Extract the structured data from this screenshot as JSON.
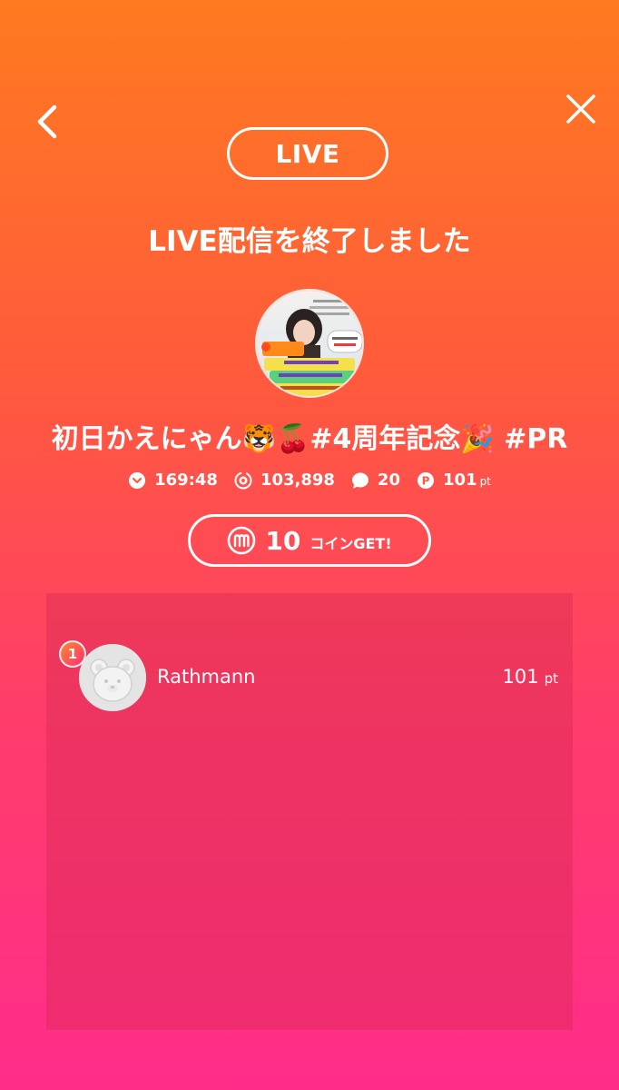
{
  "header": {
    "live_label": "LIVE"
  },
  "end_message": "LIVE配信を終了しました",
  "stream": {
    "title": "初日かえにゃん🐯🍒#4周年記念🎉 #PR"
  },
  "stats": {
    "duration": "169:48",
    "views": "103,898",
    "comments": "20",
    "points": "101",
    "points_unit": "pt"
  },
  "coin": {
    "amount": "10",
    "label": "コインGET!"
  },
  "ranking": [
    {
      "rank": "1",
      "name": "Rathmann",
      "points": "101",
      "unit": "pt"
    }
  ],
  "colors": {
    "gradient_top": "#ff7a1f",
    "gradient_bottom": "#ff2d8a",
    "panel": "#d62854",
    "badge": "#ff5a3d"
  }
}
